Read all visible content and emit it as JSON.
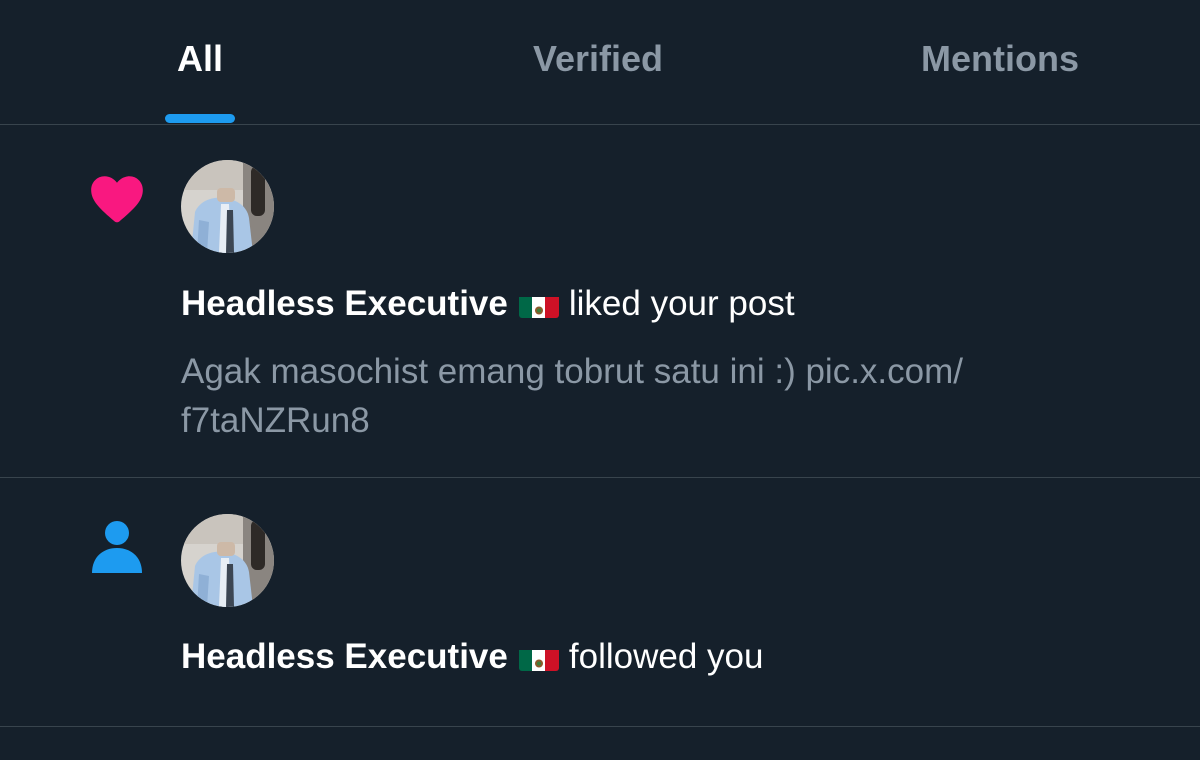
{
  "tabs": [
    {
      "label": "All",
      "active": true
    },
    {
      "label": "Verified",
      "active": false
    },
    {
      "label": "Mentions",
      "active": false
    }
  ],
  "colors": {
    "background": "#15202b",
    "accent": "#1d9bf0",
    "like": "#f91880",
    "muted_text": "#8b98a5",
    "divider": "#38444d"
  },
  "notifications": [
    {
      "type": "like",
      "icon": "heart-icon",
      "actor_name": "Headless Executive",
      "actor_flag": "mexico-flag-icon",
      "action_text": "liked your post",
      "post_preview_line1": "Agak masochist emang tobrut satu ini :) pic.x.com/",
      "post_preview_line2": "f7taNZRun8"
    },
    {
      "type": "follow",
      "icon": "person-icon",
      "actor_name": "Headless Executive",
      "actor_flag": "mexico-flag-icon",
      "action_text": "followed you"
    }
  ]
}
